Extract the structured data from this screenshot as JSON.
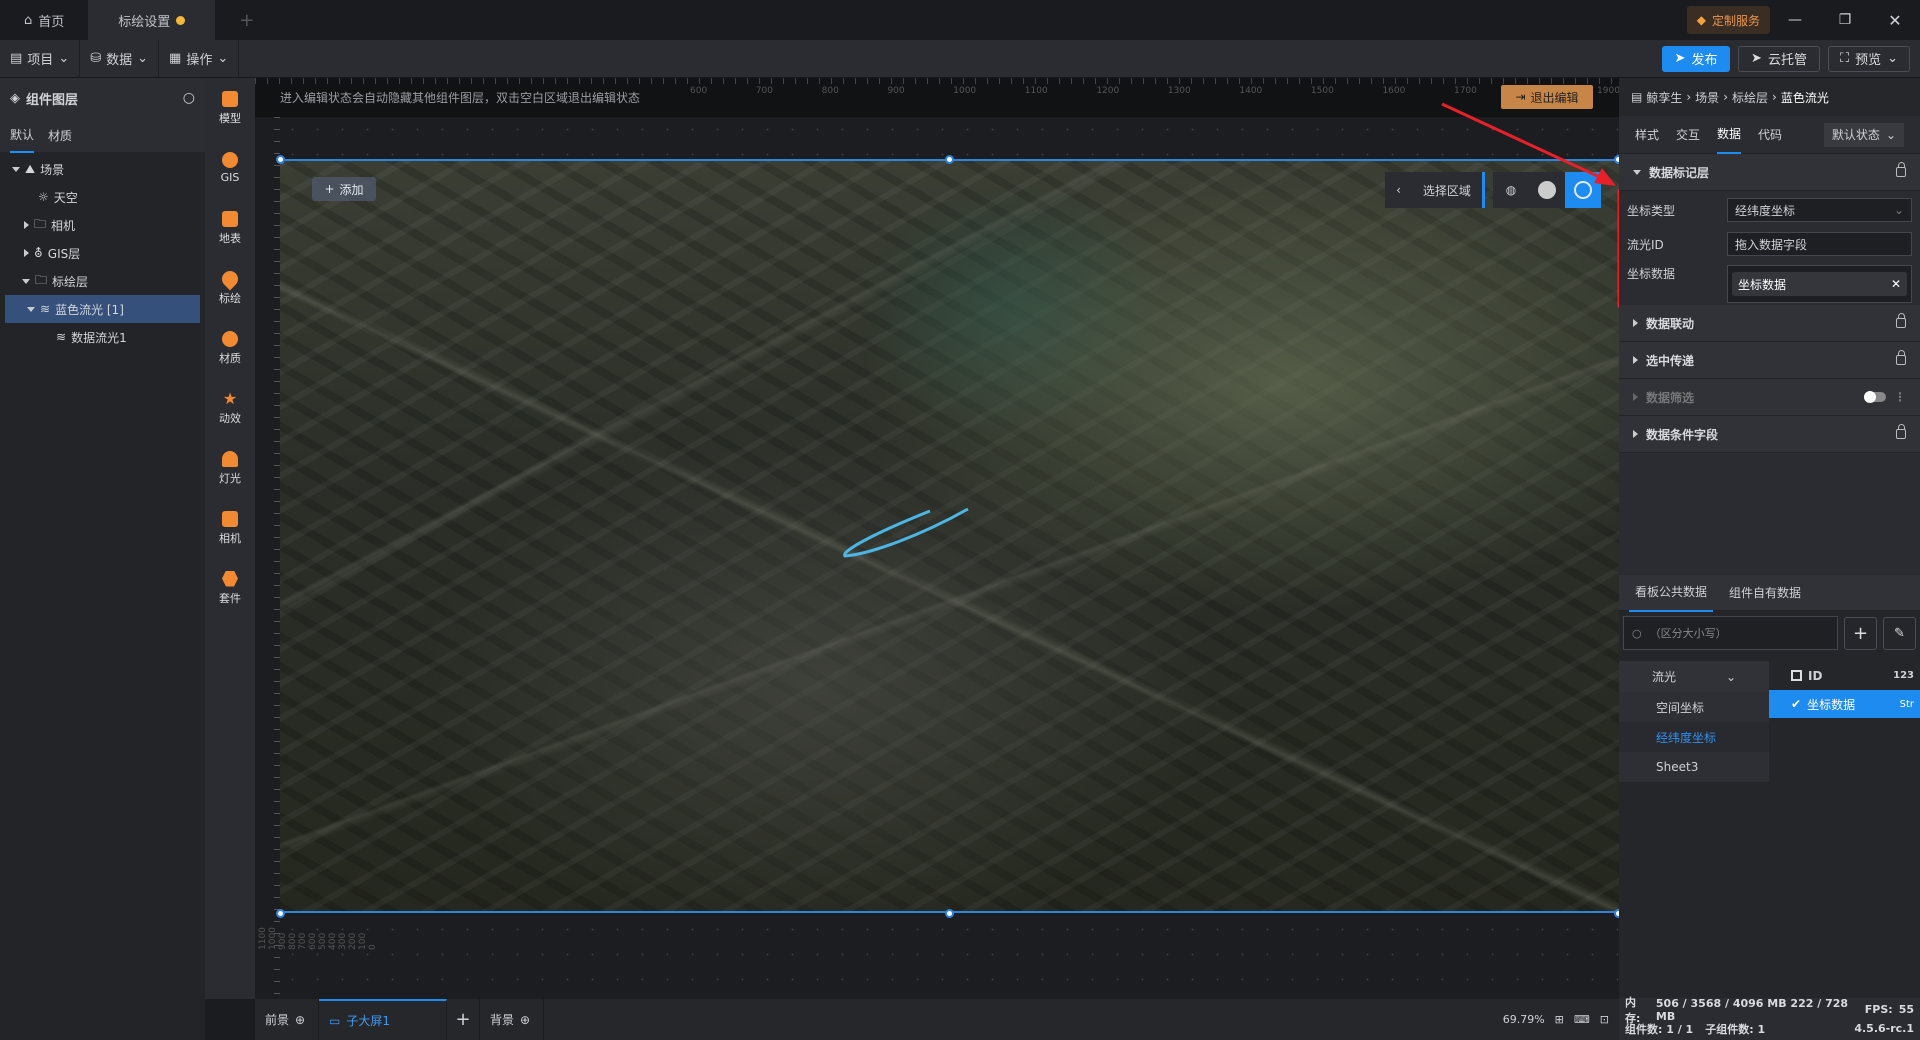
{
  "window": {
    "tabs": [
      {
        "label": "首页",
        "icon": "home-icon"
      },
      {
        "label": "标绘设置",
        "unsaved": true
      }
    ],
    "custom_service": "定制服务"
  },
  "toolbar": {
    "menus": [
      "项目",
      "数据",
      "操作"
    ],
    "publish": "发布",
    "cloud": "云托管",
    "preview": "预览"
  },
  "left": {
    "title": "组件图层",
    "tabs": [
      "默认",
      "材质"
    ],
    "tree": [
      {
        "label": "场景",
        "level": 0,
        "expanded": true
      },
      {
        "label": "天空",
        "level": 1
      },
      {
        "label": "相机",
        "level": 1,
        "collapsed": true
      },
      {
        "label": "GIS层",
        "level": 1,
        "collapsed": true
      },
      {
        "label": "标绘层",
        "level": 1,
        "expanded": true
      },
      {
        "label": "蓝色流光 [1]",
        "level": 2,
        "selected": true
      },
      {
        "label": "数据流光1",
        "level": 3
      }
    ]
  },
  "iconbar": [
    "模型",
    "GIS",
    "地表",
    "标绘",
    "材质",
    "动效",
    "灯光",
    "相机",
    "套件"
  ],
  "canvas": {
    "hint": "进入编辑状态会自动隐藏其他组件图层，双击空白区域退出编辑状态",
    "exit_edit": "退出编辑",
    "add": "添加",
    "select_area": "选择区域",
    "ruler_top": [
      "600",
      "700",
      "800",
      "900",
      "1000",
      "1100",
      "1200",
      "1300",
      "1400",
      "1500",
      "1600",
      "1700",
      "1800",
      "1900"
    ],
    "ruler_left": [
      "0",
      "100",
      "200",
      "300",
      "400",
      "500",
      "600",
      "700",
      "800",
      "900",
      "1000",
      "1100"
    ]
  },
  "bottom": {
    "foreground": "前景",
    "screen": "子大屏1",
    "background": "背景",
    "zoom": "69.79%"
  },
  "right": {
    "breadcrumb": [
      "鲸孪生",
      "场景",
      "标绘层",
      "蓝色流光"
    ],
    "tabs": [
      "样式",
      "交互",
      "数据",
      "代码"
    ],
    "active_tab": "数据",
    "state": "默认状态",
    "section": "数据标记层",
    "fields": {
      "coord_type_label": "坐标类型",
      "coord_type_value": "经纬度坐标",
      "flow_id_label": "流光ID",
      "flow_id_placeholder": "拖入数据字段",
      "coord_data_label": "坐标数据",
      "coord_data_value": "坐标数据"
    },
    "sections": [
      "数据联动",
      "选中传递",
      "数据筛选",
      "数据条件字段"
    ],
    "data_tabs": [
      "看板公共数据",
      "组件自有数据"
    ],
    "search_placeholder": "（区分大小写）",
    "sources": {
      "selected": "流光",
      "items": [
        "空间坐标",
        "经纬度坐标",
        "Sheet3"
      ],
      "active": "经纬度坐标"
    },
    "fields_list": [
      {
        "name": "ID",
        "type": "123",
        "checked": false
      },
      {
        "name": "坐标数据",
        "type": "Str",
        "checked": true
      }
    ]
  },
  "status": {
    "memory_label": "内存:",
    "memory": "506 / 3568 / 4096 MB  222 / 728 MB",
    "fps_label": "FPS:",
    "fps": "55",
    "components": "组件数: 1 / 1",
    "children": "子组件数: 1",
    "version": "4.5.6-rc.1"
  },
  "colors": {
    "accent": "#1890ff",
    "annotation": "#e8202a",
    "orange": "#f28a33"
  }
}
